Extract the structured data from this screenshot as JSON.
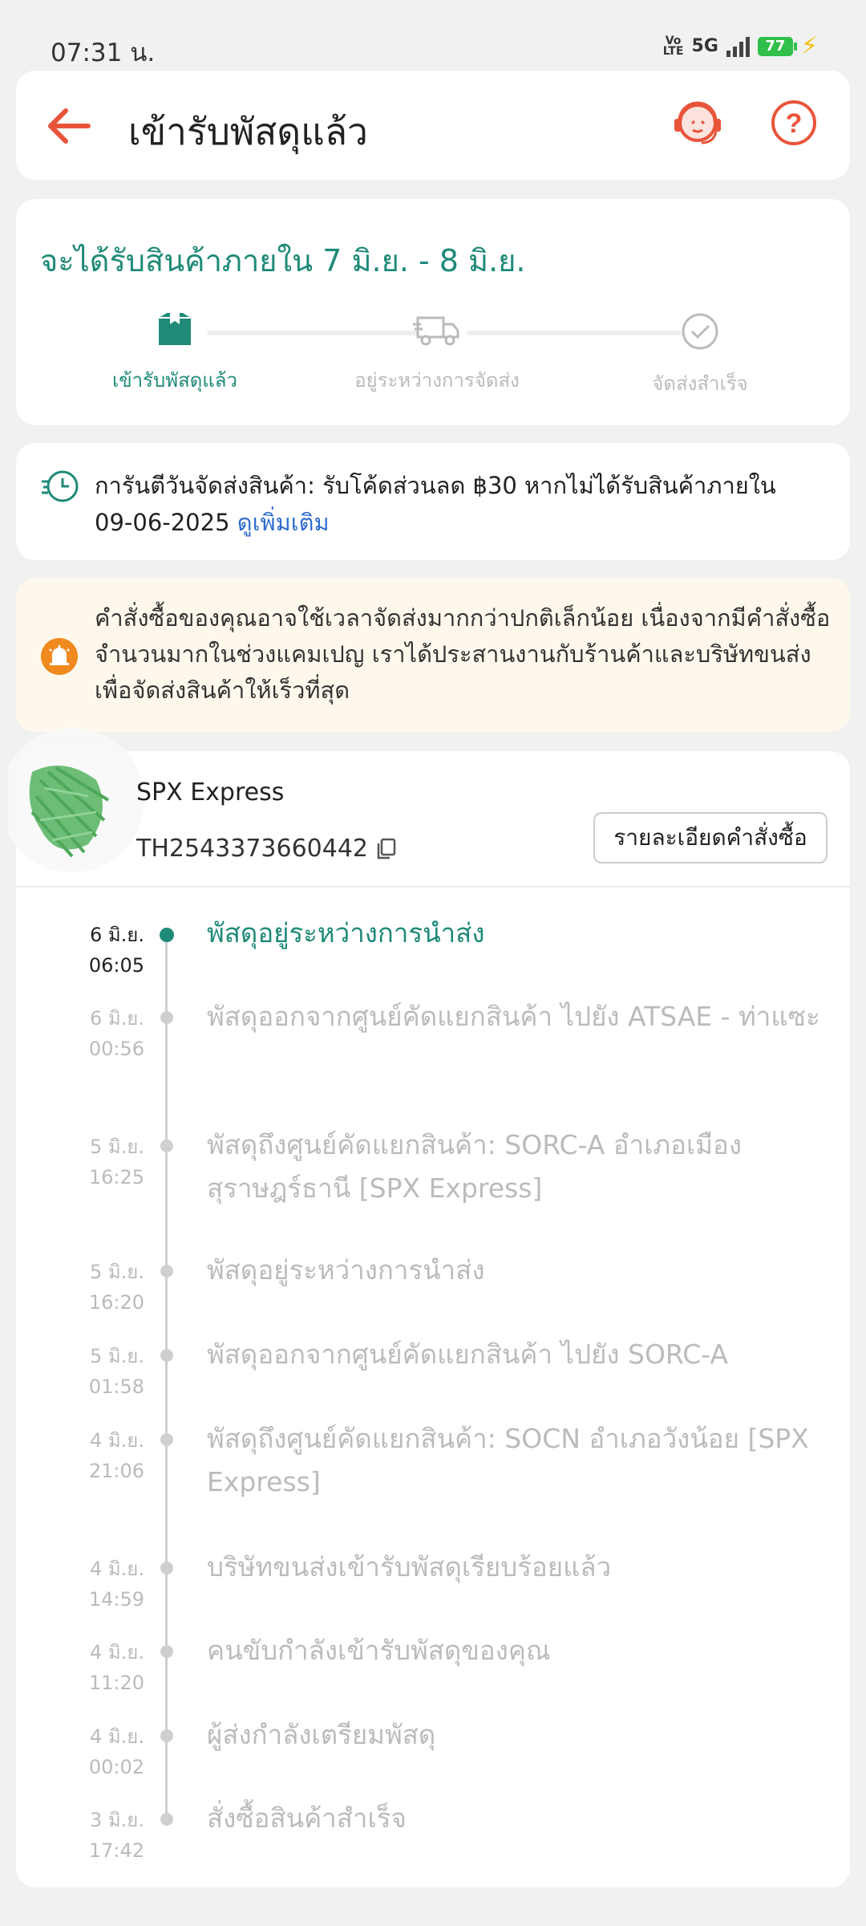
{
  "status_bar": {
    "time": "07:31 น.",
    "network": "5G",
    "volte": "Vo LTE",
    "battery": "77"
  },
  "header": {
    "title": "เข้ารับพัสดุแล้ว",
    "back_icon": "back-arrow-icon",
    "support_icon": "support-agent-icon",
    "help_icon": "help-icon",
    "accent_color": "#e8543a"
  },
  "estimate": {
    "text": "จะได้รับสินค้าภายใน 7 มิ.ย. - 8 มิ.ย.",
    "steps": [
      {
        "label": "เข้ารับพัสดุแล้ว",
        "icon": "package-icon",
        "active": true
      },
      {
        "label": "อยู่ระหว่างการจัดส่ง",
        "icon": "truck-icon",
        "active": false
      },
      {
        "label": "จัดส่งสำเร็จ",
        "icon": "check-circle-icon",
        "active": false
      }
    ],
    "accent_color": "#1f8a78"
  },
  "guarantee": {
    "text": "การันตีวันจัดส่งสินค้า: รับโค้ดส่วนลด ฿30 หากไม่ได้รับสินค้าภายใน 09-06-2025",
    "link": "ดูเพิ่มเติม"
  },
  "notice": {
    "text": "คำสั่งซื้อของคุณอาจใช้เวลาจัดส่งมากกว่าปกติเล็กน้อย เนื่องจากมีคำสั่งซื้อจำนวนมากในช่วงแคมเปญ เราได้ประสานงานกับร้านค้าและบริษัทขนส่งเพื่อจัดส่งสินค้าให้เร็วที่สุด"
  },
  "shipment": {
    "courier": "SPX Express",
    "tracking_number": "TH2543373660442",
    "details_button": "รายละเอียดคำสั่งซื้อ"
  },
  "timeline": [
    {
      "date": "6 มิ.ย.",
      "time": "06:05",
      "text": "พัสดุอยู่ระหว่างการนำส่ง",
      "active": true
    },
    {
      "date": "6 มิ.ย.",
      "time": "00:56",
      "text": "พัสดุออกจากศูนย์คัดแยกสินค้า ไปยัง ATSAE - ท่าแซะ"
    },
    {
      "date": "5 มิ.ย.",
      "time": "16:25",
      "text": "พัสดุถึงศูนย์คัดแยกสินค้า: SORC-A อำเภอเมืองสุราษฎร์ธานี [SPX Express]"
    },
    {
      "date": "5 มิ.ย.",
      "time": "16:20",
      "text": "พัสดุอยู่ระหว่างการนำส่ง"
    },
    {
      "date": "5 มิ.ย.",
      "time": "01:58",
      "text": "พัสดุออกจากศูนย์คัดแยกสินค้า ไปยัง SORC-A"
    },
    {
      "date": "4 มิ.ย.",
      "time": "21:06",
      "text": "พัสดุถึงศูนย์คัดแยกสินค้า: SOCN อำเภอวังน้อย [SPX Express]"
    },
    {
      "date": "4 มิ.ย.",
      "time": "14:59",
      "text": "บริษัทขนส่งเข้ารับพัสดุเรียบร้อยแล้ว"
    },
    {
      "date": "4 มิ.ย.",
      "time": "11:20",
      "text": "คนขับกำลังเข้ารับพัสดุของคุณ"
    },
    {
      "date": "4 มิ.ย.",
      "time": "00:02",
      "text": " ผู้ส่งกำลังเตรียมพัสดุ"
    },
    {
      "date": "3 มิ.ย.",
      "time": "17:42",
      "text": "สั่งซื้อสินค้าสำเร็จ"
    }
  ]
}
